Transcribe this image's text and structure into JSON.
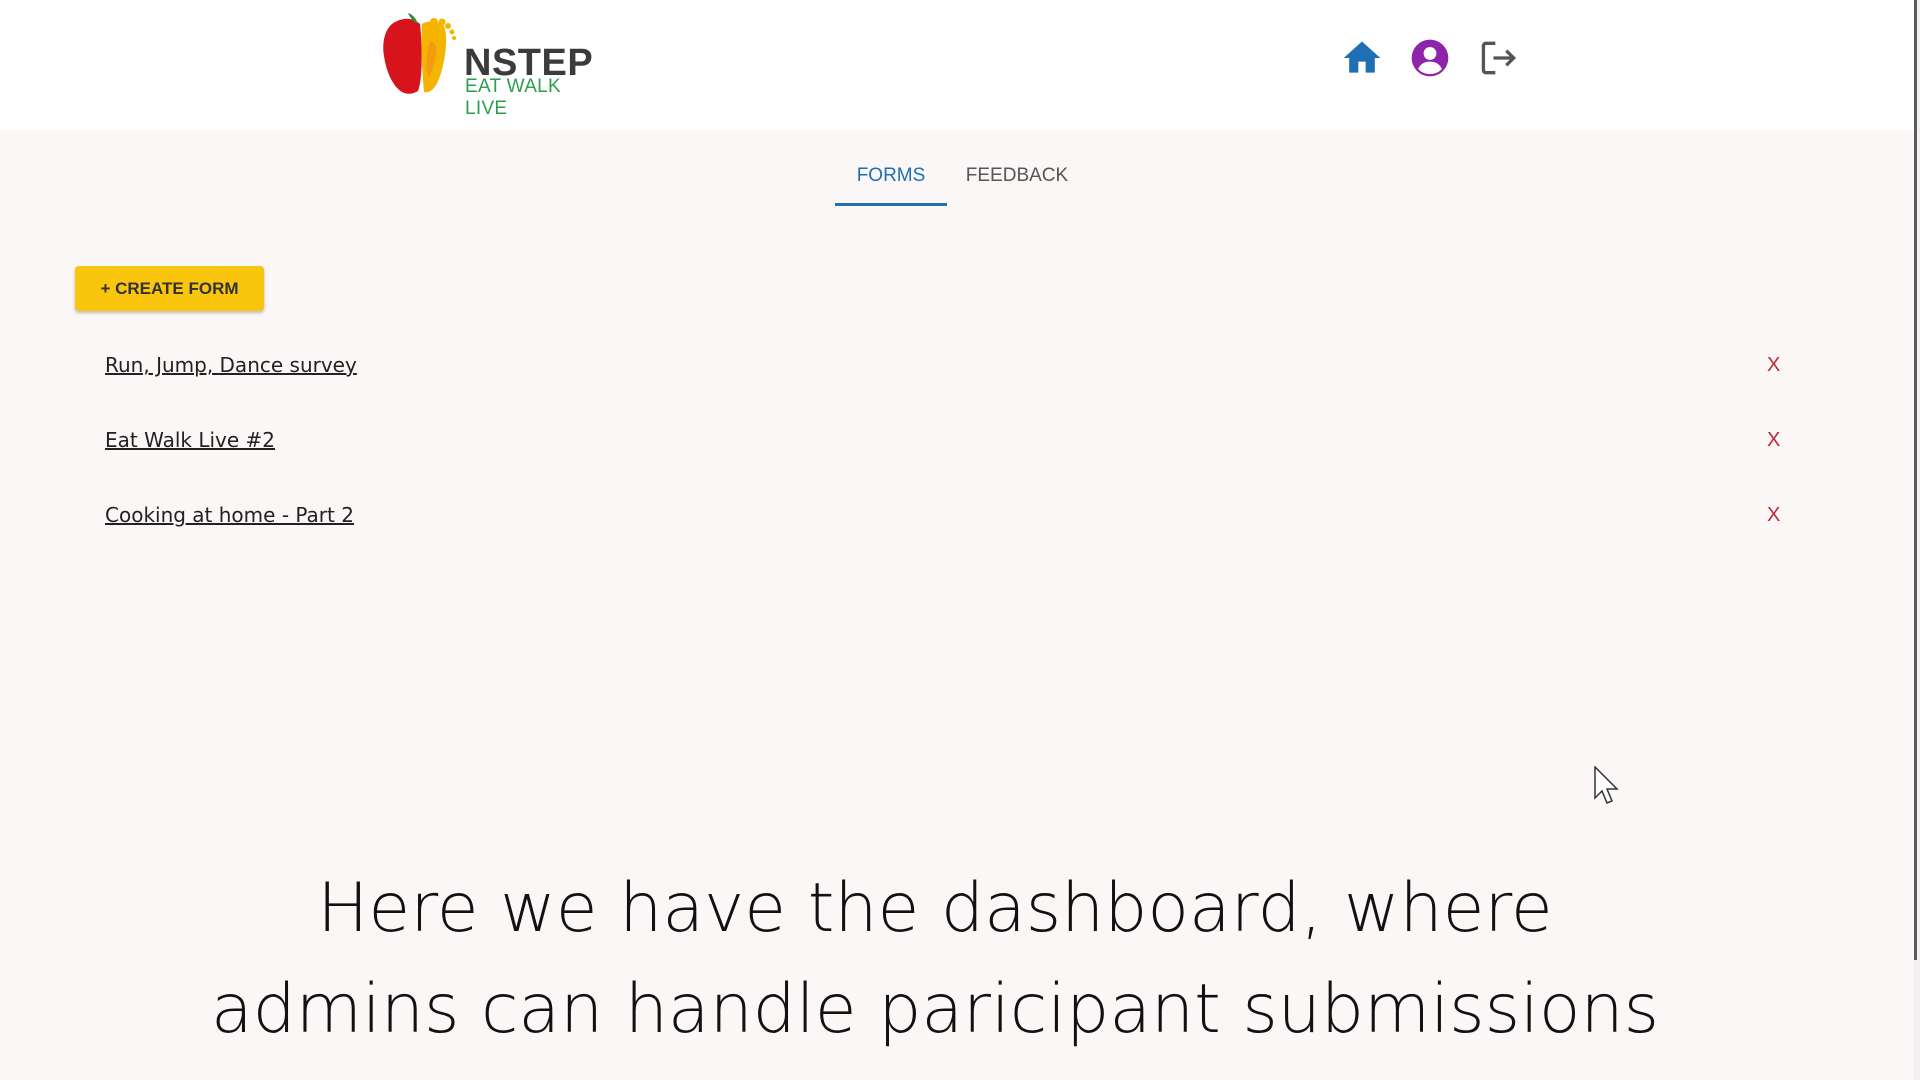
{
  "header": {
    "brand_name": "NSTEP",
    "brand_tagline": "EAT WALK LIVE",
    "icons": [
      "home-icon",
      "account-circle-icon",
      "logout-icon"
    ],
    "colors": {
      "home": "#1f6fb5",
      "account": "#8e24aa",
      "logout": "#555555"
    }
  },
  "tabs": [
    {
      "label": "FORMS",
      "active": true
    },
    {
      "label": "FEEDBACK",
      "active": false
    }
  ],
  "toolbar": {
    "create_label": "+ CREATE FORM"
  },
  "forms": [
    {
      "title": "Run, Jump, Dance survey",
      "delete_label": "X"
    },
    {
      "title": "Eat Walk Live #2",
      "delete_label": "X"
    },
    {
      "title": "Cooking at home - Part 2",
      "delete_label": "X"
    }
  ],
  "caption": {
    "line1": "Here we have the dashboard, where",
    "line2": "admins can handle paricipant submissions"
  },
  "colors": {
    "accent": "#1f6fb5",
    "button": "#f9c50d",
    "delete": "#c0283a",
    "background": "#faf7f6"
  }
}
